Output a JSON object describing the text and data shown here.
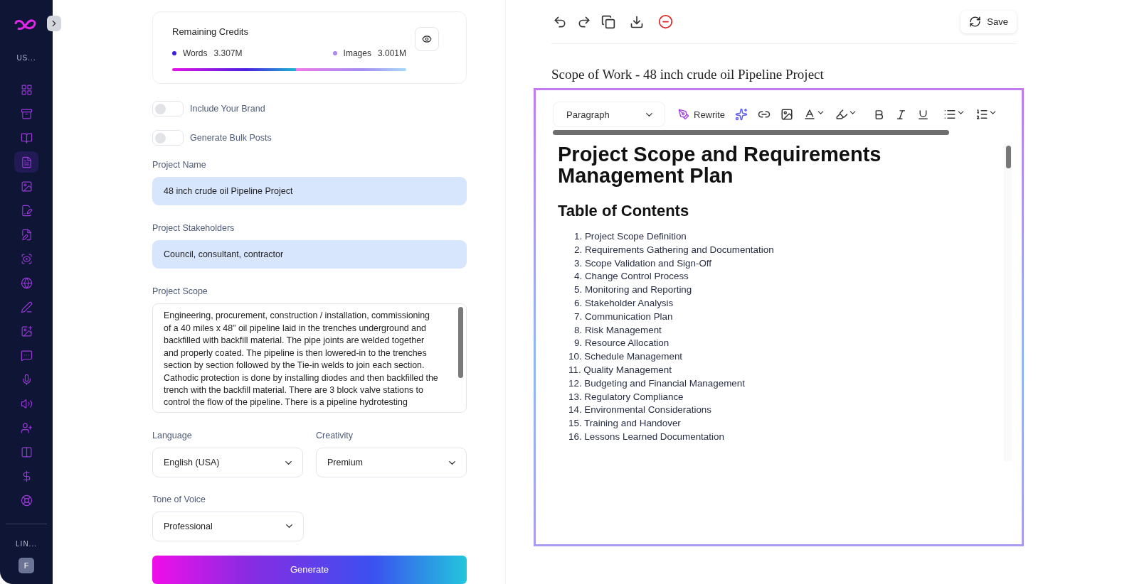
{
  "sidebar": {
    "top_label": "US...",
    "bottom_label": "LIN...",
    "avatar": "F",
    "items": [
      {
        "selected": false
      },
      {
        "selected": false
      },
      {
        "selected": false
      },
      {
        "selected": true
      },
      {
        "selected": false
      },
      {
        "selected": false
      },
      {
        "selected": false
      },
      {
        "selected": false
      },
      {
        "selected": false
      },
      {
        "selected": false
      },
      {
        "selected": false
      },
      {
        "selected": false
      },
      {
        "selected": false
      },
      {
        "selected": false
      },
      {
        "selected": false
      },
      {
        "selected": false
      },
      {
        "selected": false
      },
      {
        "selected": false
      }
    ]
  },
  "credits": {
    "title": "Remaining Credits",
    "items": [
      {
        "label": "Words",
        "value": "3.307M",
        "color": "#3b1fe0",
        "level": 0.53
      },
      {
        "label": "Images",
        "value": "3.001M",
        "color": "#a98af0",
        "level": 0.47
      }
    ]
  },
  "toggles": [
    {
      "label": "Include Your Brand",
      "on": false
    },
    {
      "label": "Generate Bulk Posts",
      "on": false
    }
  ],
  "fields": [
    {
      "label": "Project Name",
      "value": "48 inch crude oil Pipeline Project"
    },
    {
      "label": "Project Stakeholders",
      "value": "Council, consultant, contractor"
    }
  ],
  "scope": {
    "label": "Project Scope",
    "value": "Engineering, procurement, construction / installation, commissioning of a 40 miles x 48\" oil pipeline laid in the trenches underground and backfilled with backfill material. The pipe joints are welded together and properly coated. The pipeline is then lowered-in to the trenches section by section followed by the Tie-in welds to join each section. Cathodic protection is done by installing diodes and then backfilled the trench with the backfill material. There are 3 block valve stations to control the flow of the pipeline. There is a pipeline hydrotesting"
  },
  "selects": [
    {
      "label": "Language",
      "value": "English (USA)"
    },
    {
      "label": "Creativity",
      "value": "Premium"
    },
    {
      "label": "Tone of Voice",
      "value": "Professional"
    }
  ],
  "generate_button": "Generate",
  "save_button": "Save",
  "document_title": "Scope of Work - 48 inch crude oil Pipeline Project",
  "editor": {
    "block_type": "Paragraph",
    "rewrite": "Rewrite",
    "heading": "Project Scope and Requirements Management Plan",
    "toc_heading": "Table of Contents",
    "toc": [
      "1. Project Scope Definition",
      "2. Requirements Gathering and Documentation",
      "3. Scope Validation and Sign-Off",
      "4. Change Control Process",
      "5. Monitoring and Reporting",
      "6. Stakeholder Analysis",
      "7. Communication Plan",
      "8. Risk Management",
      "9. Resource Allocation",
      "10. Schedule Management",
      "11. Quality Management",
      "12. Budgeting and Financial Management",
      "13. Regulatory Compliance",
      "14. Environmental Considerations",
      "15. Training and Handover",
      "16. Lessons Learned Documentation"
    ]
  }
}
